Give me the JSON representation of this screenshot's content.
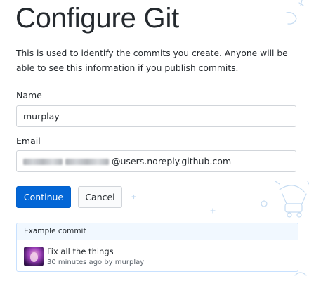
{
  "page": {
    "title": "Configure Git",
    "description": "This is used to identify the commits you create. Anyone will be able to see this information if you publish commits."
  },
  "form": {
    "name_label": "Name",
    "name_value": "murplay",
    "email_label": "Email",
    "email_visible_suffix": "@users.noreply.github.com"
  },
  "actions": {
    "continue_label": "Continue",
    "cancel_label": "Cancel"
  },
  "example_commit": {
    "header": "Example commit",
    "summary": "Fix all the things",
    "meta": "30 minutes ago by murplay"
  },
  "colors": {
    "accent": "#0366d6",
    "text": "#24292e",
    "muted": "#586069",
    "border": "#d1d5da",
    "example_border": "#c8e1ff",
    "example_header_bg": "#f1f8ff"
  },
  "icons": [
    "user-avatar-icon",
    "doodle-decoration-icon"
  ]
}
